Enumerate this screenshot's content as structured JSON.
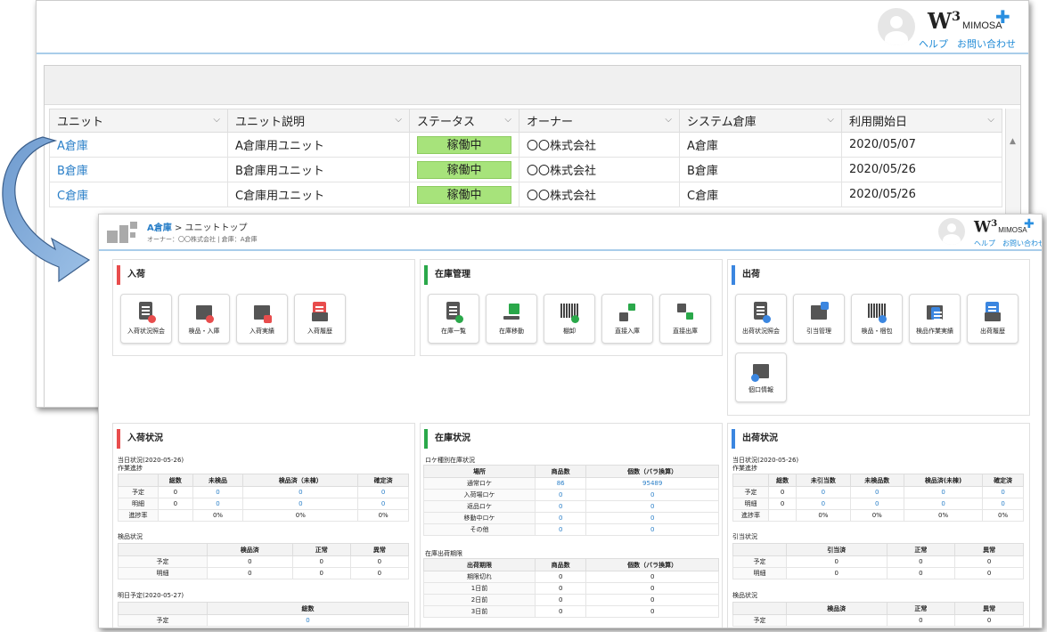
{
  "header": {
    "brand": "W",
    "brand_sup": "3",
    "brand_sub": "MIMOSA",
    "help": "ヘルプ",
    "contact": "お問い合わせ"
  },
  "grid": {
    "columns": [
      "ユニット",
      "ユニット説明",
      "ステータス",
      "オーナー",
      "システム倉庫",
      "利用開始日"
    ],
    "rows": [
      [
        "A倉庫",
        "A倉庫用ユニット",
        "稼働中",
        "〇〇株式会社",
        "A倉庫",
        "2020/05/07"
      ],
      [
        "B倉庫",
        "B倉庫用ユニット",
        "稼働中",
        "〇〇株式会社",
        "B倉庫",
        "2020/05/26"
      ],
      [
        "C倉庫",
        "C倉庫用ユニット",
        "稼働中",
        "〇〇株式会社",
        "C倉庫",
        "2020/05/26"
      ]
    ]
  },
  "unit": {
    "crumb_link": "A倉庫",
    "crumb_rest": "> ユニットトップ",
    "crumb_sub": "オーナー：〇〇株式会社 | 倉庫：A倉庫"
  },
  "menus": {
    "inbound": {
      "title": "入荷",
      "tiles": [
        "入荷状況照会",
        "検品・入庫",
        "入荷実績",
        "入荷履歴"
      ]
    },
    "stock": {
      "title": "在庫管理",
      "tiles": [
        "在庫一覧",
        "在庫移動",
        "棚卸",
        "直接入庫",
        "直接出庫"
      ]
    },
    "outbound": {
      "title": "出荷",
      "tiles": [
        "出荷状況照会",
        "引当管理",
        "検品・梱包",
        "検品作業実績",
        "出荷履歴",
        "個口情報"
      ]
    }
  },
  "inbound_status": {
    "title": "入荷状況",
    "today": "当日状況(2020-05-26)",
    "progress_label": "作業進捗",
    "progress_head": [
      "",
      "総数",
      "未検品",
      "検品済（未棟）",
      "確定済"
    ],
    "progress_rows": [
      [
        "予定",
        "0",
        "0",
        "0",
        "0"
      ],
      [
        "明細",
        "0",
        "0",
        "0",
        "0"
      ],
      [
        "進捗率",
        "",
        "0%",
        "0%",
        "0%"
      ]
    ],
    "inspect_label": "検品状況",
    "inspect_head": [
      "",
      "検品済",
      "正常",
      "異常"
    ],
    "inspect_rows": [
      [
        "予定",
        "0",
        "0",
        "0"
      ],
      [
        "明細",
        "0",
        "0",
        "0"
      ]
    ],
    "tomorrow": "明日予定(2020-05-27)",
    "tomorrow_head": [
      "",
      "総数"
    ],
    "tomorrow_rows": [
      [
        "予定",
        "0"
      ]
    ]
  },
  "stock_status": {
    "title": "在庫状況",
    "loc_label": "ロケ種別在庫状況",
    "loc_head": [
      "場所",
      "商品数",
      "個数（バラ換算）"
    ],
    "loc_rows": [
      [
        "通常ロケ",
        "86",
        "95489"
      ],
      [
        "入荷場ロケ",
        "0",
        "0"
      ],
      [
        "返品ロケ",
        "0",
        "0"
      ],
      [
        "移動中ロケ",
        "0",
        "0"
      ],
      [
        "その他",
        "0",
        "0"
      ]
    ],
    "exp_label": "在庫出荷期限",
    "exp_head": [
      "出荷期限",
      "商品数",
      "個数（バラ換算）"
    ],
    "exp_rows": [
      [
        "期限切れ",
        "0",
        "0"
      ],
      [
        "1日前",
        "0",
        "0"
      ],
      [
        "2日前",
        "0",
        "0"
      ],
      [
        "3日前",
        "0",
        "0"
      ]
    ]
  },
  "outbound_status": {
    "title": "出荷状況",
    "today": "当日状況(2020-05-26)",
    "progress_label": "作業進捗",
    "progress_head": [
      "",
      "総数",
      "未引当数",
      "未検品数",
      "検品済(未棟)",
      "確定済"
    ],
    "progress_rows": [
      [
        "予定",
        "0",
        "0",
        "0",
        "0",
        "0"
      ],
      [
        "明細",
        "0",
        "0",
        "0",
        "0",
        "0"
      ],
      [
        "進捗率",
        "",
        "0%",
        "0%",
        "0%",
        "0%"
      ]
    ],
    "alloc_label": "引当状況",
    "alloc_head": [
      "",
      "引当済",
      "正常",
      "異常"
    ],
    "alloc_rows": [
      [
        "予定",
        "0",
        "0",
        "0"
      ],
      [
        "明細",
        "0",
        "0",
        "0"
      ]
    ],
    "inspect_label": "検品状況",
    "inspect_head": [
      "",
      "検品済",
      "正常",
      "異常"
    ],
    "inspect_rows": [
      [
        "予定",
        "",
        "0",
        "0"
      ]
    ]
  },
  "colors": {
    "inbound": "#e84d4d",
    "stock": "#2aa84a",
    "outbound": "#3b86e0",
    "status_badge": "#a7e37b",
    "link": "#2a7fc8"
  }
}
